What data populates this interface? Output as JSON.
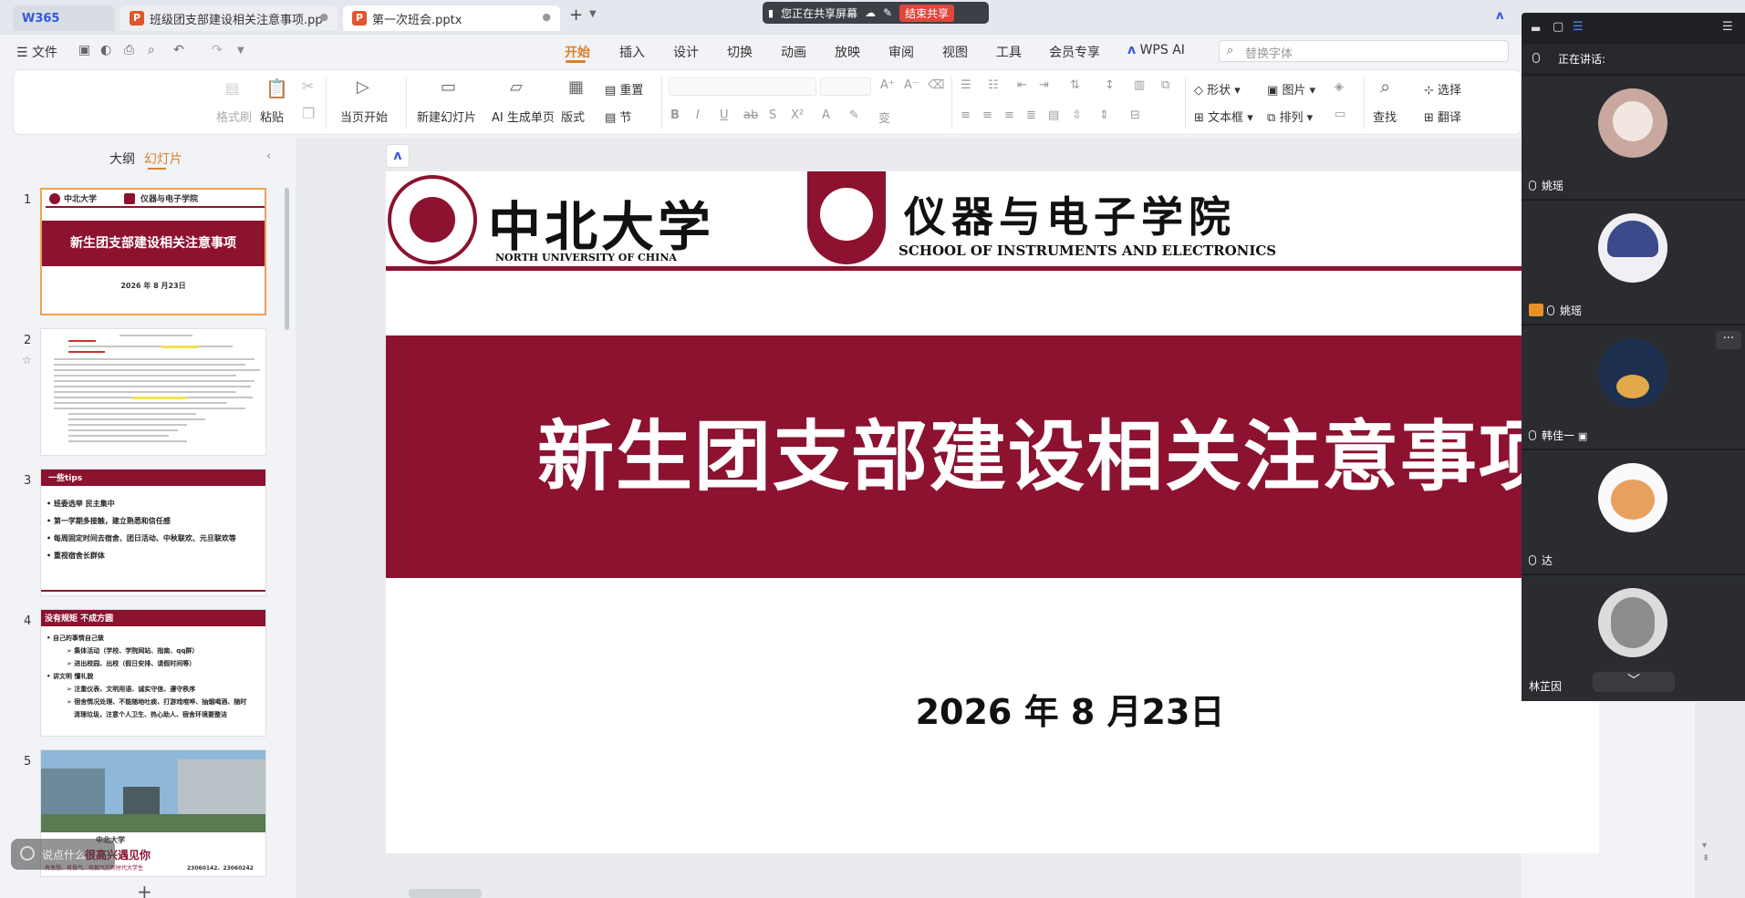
{
  "tabs": {
    "home": "W365",
    "doc1": "班级团支部建设相关注意事项.pp",
    "doc2": "第一次班会.pptx",
    "add": "+"
  },
  "share_bar": {
    "status": "您正在共享屏幕",
    "stop": "结束共享"
  },
  "menu": {
    "file": "文件",
    "items": [
      "开始",
      "插入",
      "设计",
      "切换",
      "动画",
      "放映",
      "审阅",
      "视图",
      "工具",
      "会员专享",
      "WPS AI"
    ],
    "active": "开始",
    "font_search_placeholder": "替换字体"
  },
  "ribbon": {
    "format_painter": "格式刷",
    "paste": "粘贴",
    "play_from_current": "当页开始",
    "new_slide": "新建幻灯片",
    "ai_single": "AI 生成单页",
    "layout": "版式",
    "reset": "重置",
    "section": "节",
    "shape": "形状",
    "textbox": "文本框",
    "picture": "图片",
    "arrange": "排列",
    "find": "查找",
    "select": "选择",
    "translate": "翻译"
  },
  "left_panel": {
    "outline_tab": "大纲",
    "slides_tab": "幻灯片",
    "collapse": "‹",
    "slide_numbers": [
      "1",
      "2",
      "3",
      "4",
      "5"
    ],
    "thumb1": {
      "title": "新生团支部建设相关注意事项",
      "date": "2026 年 8 月23日"
    },
    "thumb3": {
      "heading": "一些tips",
      "bullets": [
        "班委选举 民主集中",
        "第一学期多接触，建立熟悉和信任感",
        "每周固定时间去宿舍、团日活动、中秋联欢、元旦联欢等",
        "重视宿舍长群体"
      ]
    },
    "thumb4": {
      "heading": "没有规矩 不成方圆",
      "items": [
        "自己的事情自己做",
        "➢ 集体活动（学校、学院网站、指南、qq群）",
        "➢ 进出校园、出校（假日安排、请假时间等）",
        "讲文明 懂礼貌",
        "➢ 注重仪表、文明用语、诚实守信、遵守秩序",
        "➢ 宿舍情况处理、不能随地吐痰、打游戏喧哗、抽烟喝酒、随时",
        "清理垃圾，注意个人卫生、热心助人、宿舍环境要整洁"
      ]
    },
    "thumb5": {
      "caption": "很高兴遇见你",
      "sub": "有思想、有骨气、有朝气的新时代大学生",
      "codes": "23060142、23060242"
    },
    "float_button": "说点什么"
  },
  "slide": {
    "university_cn": "中北大学",
    "university_en": "NORTH UNIVERSITY OF CHINA",
    "school_cn": "仪器与电子学院",
    "school_en": "SCHOOL OF INSTRUMENTS AND ELECTRONICS",
    "title": "新生团支部建设相关注意事项",
    "date": "2026 年 8 月23日"
  },
  "meeting": {
    "speaking_label": "正在讲话:",
    "participants": [
      {
        "name": "姚瑶"
      },
      {
        "name": "姚瑶"
      },
      {
        "name": "韩佳一"
      },
      {
        "name": "达"
      },
      {
        "name": "林芷因"
      }
    ],
    "more": "···",
    "expand": "﹀"
  },
  "colors": {
    "accent_orange": "#d9822b",
    "slide_maroon": "#8c1230",
    "ppt_icon": "#e2552d",
    "stop_share_red": "#e0463b"
  }
}
